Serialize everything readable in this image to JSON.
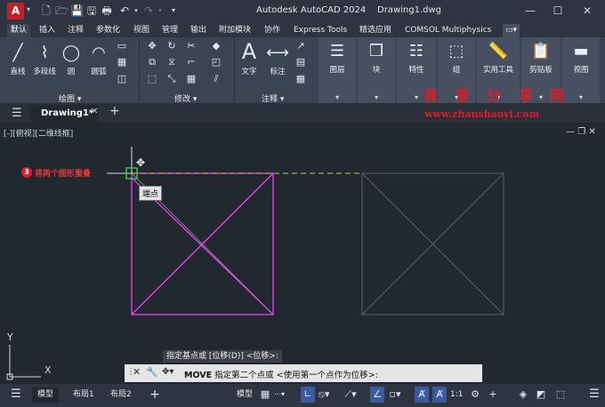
{
  "app": {
    "logo": "A",
    "title": "Autodesk AutoCAD 2024",
    "filename": "Drawing1.dwg"
  },
  "ribbon_tabs": [
    "默认",
    "插入",
    "注释",
    "参数化",
    "视图",
    "管理",
    "输出",
    "附加模块",
    "协作",
    "Express Tools",
    "精选应用",
    "COMSOL Multiphysics"
  ],
  "ribbon": {
    "draw": {
      "line": "直线",
      "polyline": "多段线",
      "circle": "圆",
      "arc": "圆弧",
      "panel": "绘图"
    },
    "modify": {
      "panel": "修改"
    },
    "annotate": {
      "text": "文字",
      "dim": "标注",
      "panel": "注释"
    },
    "layers": "图层",
    "block": "块",
    "properties": "特性",
    "group": "组",
    "utilities": "实用工具",
    "clipboard": "剪贴板",
    "view": "视图"
  },
  "watermark": {
    "cn": "我 爱 分 享 网",
    "url": "www.zhanshaoyi.com"
  },
  "doc_tab": {
    "name": "Drawing1*"
  },
  "viewport": {
    "label": "[-][俯视][二维线框]"
  },
  "annotation": {
    "step": "3",
    "text": "将两个图形重叠"
  },
  "snap_tooltip": "端点",
  "command": {
    "history": "指定基点或 [位移(D)] <位移>:",
    "name": "MOVE",
    "prompt": "指定第二个点或 <使用第一个点作为位移>:"
  },
  "ucs": {
    "x": "X",
    "y": "Y"
  },
  "layout_tabs": {
    "model": "模型",
    "layout1": "布局1",
    "layout2": "布局2"
  },
  "status": {
    "space": "模型",
    "scale": "1:1"
  },
  "colors": {
    "accent": "#3c5aa0",
    "highlight": "#ff40ff",
    "logo": "#c4202b"
  }
}
